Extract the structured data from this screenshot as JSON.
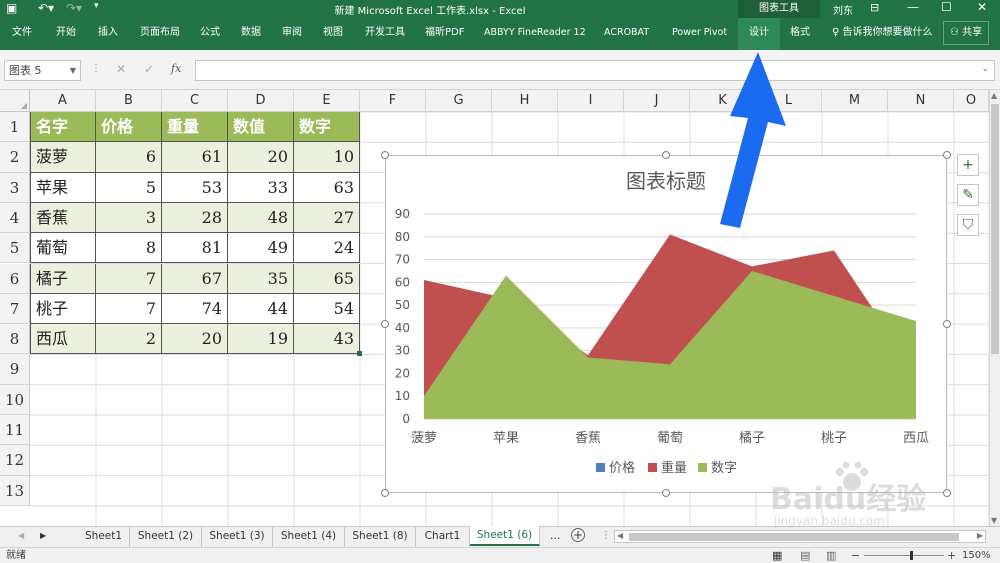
{
  "window": {
    "title": "新建 Microsoft Excel 工作表.xlsx  -  Excel",
    "context_group": "图表工具",
    "user": "刘东"
  },
  "ribbon": {
    "tabs": [
      {
        "label": "文件"
      },
      {
        "label": "开始"
      },
      {
        "label": "插入"
      },
      {
        "label": "页面布局"
      },
      {
        "label": "公式"
      },
      {
        "label": "数据"
      },
      {
        "label": "审阅"
      },
      {
        "label": "视图"
      },
      {
        "label": "开发工具"
      },
      {
        "label": "福昕PDF"
      },
      {
        "label": "ABBYY FineReader 12"
      },
      {
        "label": "ACROBAT"
      },
      {
        "label": "Power Pivot"
      }
    ],
    "context_tabs": [
      {
        "label": "设计"
      },
      {
        "label": "格式"
      }
    ],
    "tell_me": "告诉我你想要做什么",
    "share": "共享"
  },
  "formula_bar": {
    "name_box": "图表 5",
    "fx": "fx",
    "cancel": "✕",
    "enter": "✓"
  },
  "columns": [
    "A",
    "B",
    "C",
    "D",
    "E",
    "F",
    "G",
    "H",
    "I",
    "J",
    "K",
    "L",
    "M",
    "N",
    "O"
  ],
  "rows": [
    "1",
    "2",
    "3",
    "4",
    "5",
    "6",
    "7",
    "8",
    "9",
    "10",
    "11",
    "12",
    "13"
  ],
  "table": {
    "headers": [
      "名字",
      "价格",
      "重量",
      "数值",
      "数字"
    ],
    "rows": [
      [
        "菠萝",
        "6",
        "61",
        "20",
        "10"
      ],
      [
        "苹果",
        "5",
        "53",
        "33",
        "63"
      ],
      [
        "香蕉",
        "3",
        "28",
        "48",
        "27"
      ],
      [
        "葡萄",
        "8",
        "81",
        "49",
        "24"
      ],
      [
        "橘子",
        "7",
        "67",
        "35",
        "65"
      ],
      [
        "桃子",
        "7",
        "74",
        "44",
        "54"
      ],
      [
        "西瓜",
        "2",
        "20",
        "19",
        "43"
      ]
    ],
    "header_color": "#9bbb59",
    "band_color": "#ebf1de"
  },
  "chart_data": {
    "type": "area",
    "title": "图表标题",
    "categories": [
      "菠萝",
      "苹果",
      "香蕉",
      "葡萄",
      "橘子",
      "桃子",
      "西瓜"
    ],
    "series": [
      {
        "name": "价格",
        "values": [
          6,
          5,
          3,
          8,
          7,
          7,
          2
        ],
        "color": "#4f81bd"
      },
      {
        "name": "重量",
        "values": [
          61,
          53,
          28,
          81,
          67,
          74,
          20
        ],
        "color": "#c0504d"
      },
      {
        "name": "数字",
        "values": [
          10,
          63,
          27,
          24,
          65,
          54,
          43
        ],
        "color": "#9bbb59"
      }
    ],
    "ylim": [
      0,
      90
    ],
    "yticks": [
      "0",
      "10",
      "20",
      "30",
      "40",
      "50",
      "60",
      "70",
      "80",
      "90"
    ],
    "grid": true,
    "legend": "bottom"
  },
  "chart_tools": {
    "add": "+",
    "style": "brush-icon",
    "filter": "filter-icon"
  },
  "sheets": [
    {
      "label": "Sheet1"
    },
    {
      "label": "Sheet1 (2)"
    },
    {
      "label": "Sheet1 (3)"
    },
    {
      "label": "Sheet1 (4)"
    },
    {
      "label": "Sheet1 (8)"
    },
    {
      "label": "Chart1"
    },
    {
      "label": "Sheet1 (6)"
    }
  ],
  "sheet_more": "...",
  "status": {
    "mode": "就绪",
    "zoom": "150%"
  },
  "annotation": {
    "color": "#1a6bf0"
  },
  "watermark": {
    "text": "Baidu经验",
    "url": "jingyan.baidu.com"
  }
}
